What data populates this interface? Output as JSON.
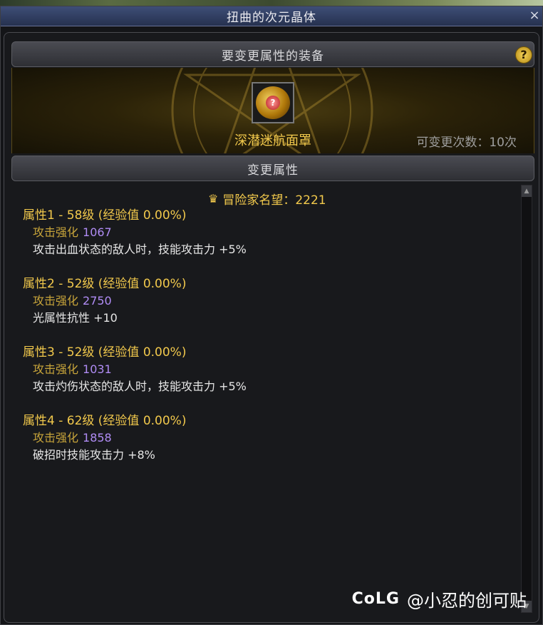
{
  "window": {
    "title": "扭曲的次元晶体",
    "close": "×"
  },
  "section1": {
    "header": "要变更属性的装备",
    "help": "?"
  },
  "equip": {
    "name": "深潜迷航面罩",
    "change_count": "可变更次数：10次",
    "gem_label": "?"
  },
  "section2": {
    "header": "变更属性"
  },
  "fame": {
    "label": "冒险家名望：2221"
  },
  "attributes": [
    {
      "title": "属性1 - 58级 (经验值 0.00%)",
      "boost_label": "攻击强化",
      "boost_value": "1067",
      "effect": "攻击出血状态的敌人时，技能攻击力 +5%"
    },
    {
      "title": "属性2 - 52级 (经验值 0.00%)",
      "boost_label": "攻击强化",
      "boost_value": "2750",
      "effect": "光属性抗性 +10"
    },
    {
      "title": "属性3 - 52级 (经验值 0.00%)",
      "boost_label": "攻击强化",
      "boost_value": "1031",
      "effect": "攻击灼伤状态的敌人时，技能攻击力 +5%"
    },
    {
      "title": "属性4 - 62级 (经验值 0.00%)",
      "boost_label": "攻击强化",
      "boost_value": "1858",
      "effect": "破招时技能攻击力 +8%"
    }
  ],
  "watermark": {
    "logo": "CoLG",
    "text": "@小忍的创可贴"
  },
  "colors": {
    "gold": "#f2c94c",
    "purple": "#b08cf5",
    "titlebar": "#2f3b5e"
  }
}
